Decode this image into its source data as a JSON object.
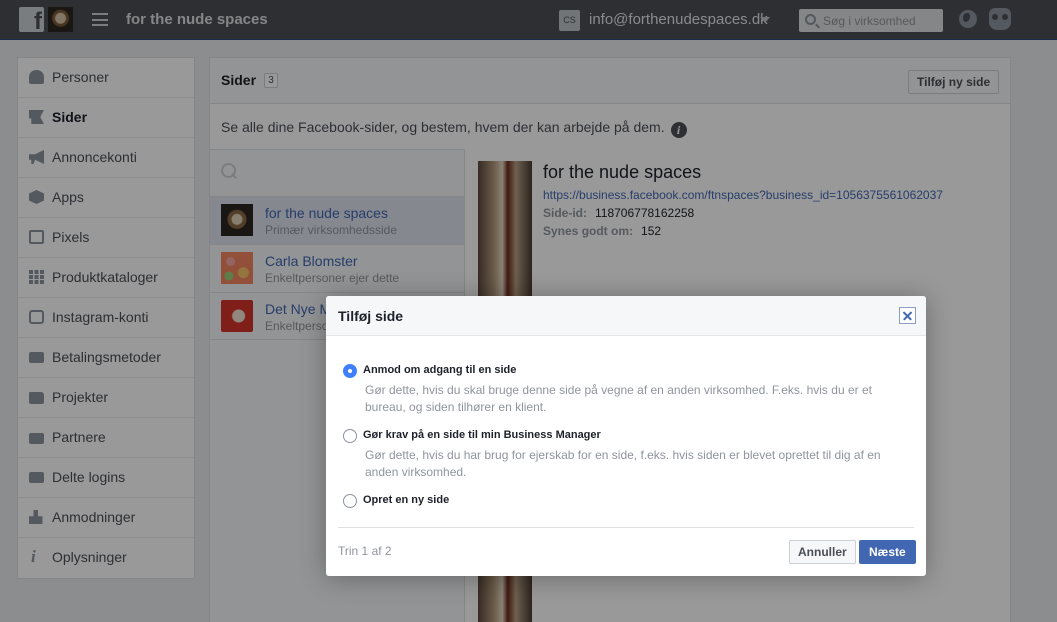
{
  "topbar": {
    "business_name": "for the nude spaces",
    "account_badge": "CS",
    "account_email": "info@forthenudespaces.dk",
    "search_placeholder": "Søg i virksomhed"
  },
  "sidebar": {
    "items": [
      {
        "label": "Personer",
        "icon": "person-icon"
      },
      {
        "label": "Sider",
        "icon": "flag-icon",
        "active": true
      },
      {
        "label": "Annoncekonti",
        "icon": "megaphone-icon"
      },
      {
        "label": "Apps",
        "icon": "cube-icon"
      },
      {
        "label": "Pixels",
        "icon": "code-icon"
      },
      {
        "label": "Produktkataloger",
        "icon": "grid-icon"
      },
      {
        "label": "Instagram-konti",
        "icon": "instagram-icon"
      },
      {
        "label": "Betalingsmetoder",
        "icon": "credit-card-icon"
      },
      {
        "label": "Projekter",
        "icon": "folder-icon"
      },
      {
        "label": "Partnere",
        "icon": "briefcase-icon"
      },
      {
        "label": "Delte logins",
        "icon": "id-card-icon"
      },
      {
        "label": "Anmodninger",
        "icon": "add-person-icon"
      },
      {
        "label": "Oplysninger",
        "icon": "info-icon"
      }
    ]
  },
  "main": {
    "title": "Sider",
    "count": "3",
    "add_button": "Tilføj ny side",
    "description": "Se alle dine Facebook-sider, og bestem, hvem der kan arbejde på dem.",
    "pages": [
      {
        "name": "for the nude spaces",
        "sub": "Primær virksomhedsside"
      },
      {
        "name": "Carla Blomster",
        "sub": "Enkeltpersoner ejer dette"
      },
      {
        "name": "Det Nye M",
        "sub": "Enkeltperso"
      }
    ],
    "detail": {
      "title": "for the nude spaces",
      "url": "https://business.facebook.com/ftnspaces?business_id=1056375561062037",
      "id_label": "Side-id:",
      "id_value": "118706778162258",
      "likes_label": "Synes godt om:",
      "likes_value": "152"
    }
  },
  "dialog": {
    "title": "Tilføj side",
    "options": [
      {
        "label": "Anmod om adgang til en side",
        "desc": "Gør dette, hvis du skal bruge denne side på vegne af en anden virksomhed. F.eks. hvis du er et bureau, og siden tilhører en klient.",
        "selected": true
      },
      {
        "label": "Gør krav på en side til min Business Manager",
        "desc": "Gør dette, hvis du har brug for ejerskab for en side, f.eks. hvis siden er blevet oprettet til dig af en anden virksomhed.",
        "selected": false
      },
      {
        "label": "Opret en ny side",
        "desc": "",
        "selected": false
      }
    ],
    "step": "Trin 1 af 2",
    "cancel": "Annuller",
    "next": "Næste"
  }
}
